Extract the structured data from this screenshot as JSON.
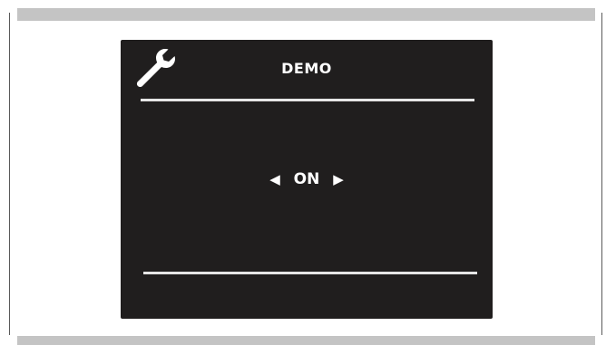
{
  "screen": {
    "title": "DEMO",
    "value": "ON",
    "left_arrow": "◀",
    "right_arrow": "▶",
    "header_icon": "wrench-icon"
  },
  "colors": {
    "screen_bg": "#201e1e",
    "frame_bar": "#c4c4c4",
    "text": "#ffffff"
  }
}
